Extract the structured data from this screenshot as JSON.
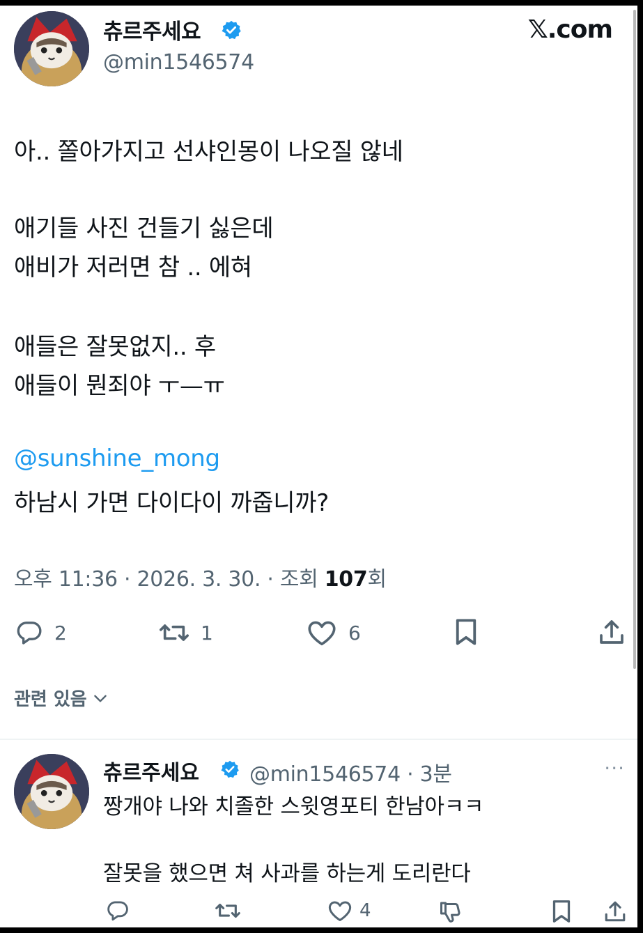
{
  "site_logo": "𝕏.com",
  "tweet": {
    "display_name": "츄르주세요",
    "handle": "@min1546574",
    "lines": [
      "아.. 쫄아가지고 선샤인몽이 나오질 않네",
      "애기들 사진 건들기 싫은데",
      "애비가 저러면 참 .. 에혀",
      "애들은 잘못없지.. 후",
      "애들이 뭔죄야 ㅜ—ㅠ",
      "@sunshine_mong",
      "하남시 가면 다이다이 까줍니까?"
    ],
    "meta_prefix": "오후 11:36 · 2026. 3. 30. · 조회 ",
    "views": "107",
    "views_suffix": "회",
    "replies": "2",
    "reposts": "1",
    "likes": "6"
  },
  "related_label": "관련 있음",
  "reply": {
    "display_name": "츄르주세요",
    "handle_time": "@min1546574 · 3분",
    "more": "···",
    "lines": [
      "짱개야 나와 치졸한 스윗영포티 한남아ㅋㅋ",
      "잘못을 했으면 쳐 사과를 하는게 도리란다"
    ],
    "likes": "4"
  },
  "colors": {
    "accent": "#1d9bf0",
    "text": "#0f1419",
    "secondary": "#536471"
  },
  "icons": [
    "verified-badge-icon",
    "reply-icon",
    "repost-icon",
    "like-icon",
    "bookmark-icon",
    "share-icon",
    "chevron-down-icon",
    "dislike-icon",
    "more-icon"
  ]
}
